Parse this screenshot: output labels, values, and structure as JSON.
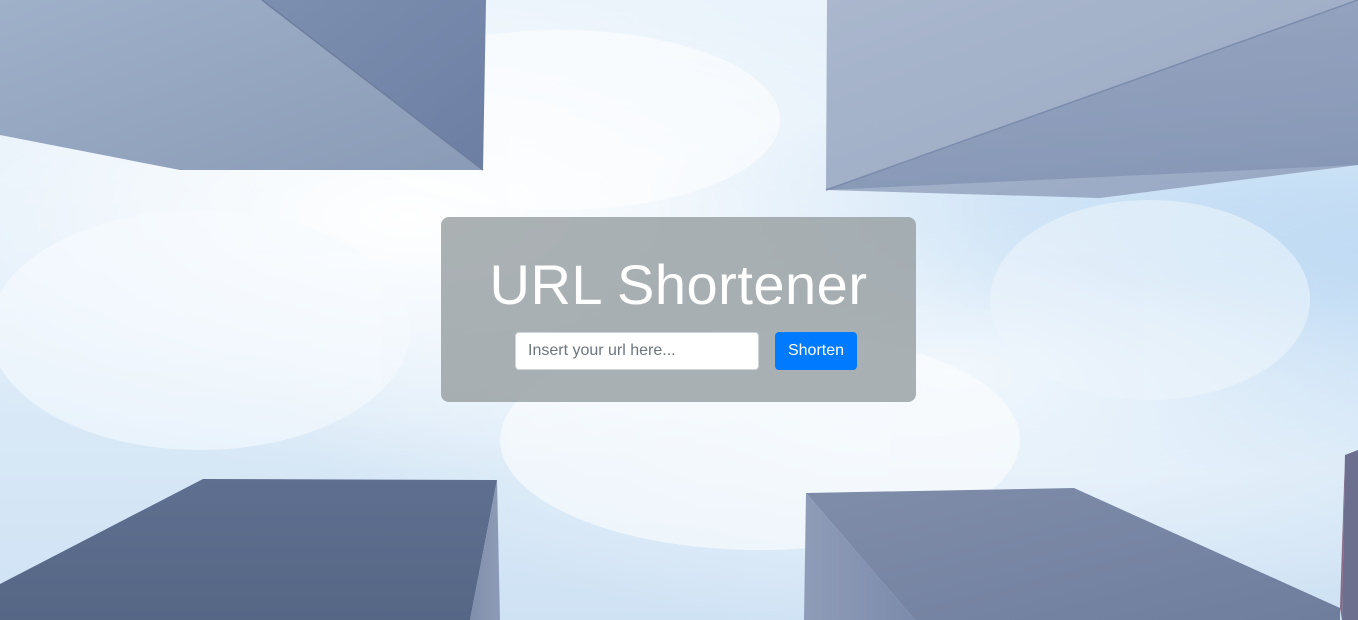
{
  "page": {
    "title": "URL Shortener"
  },
  "form": {
    "url_placeholder": "Insert your url here...",
    "url_value": "",
    "submit_label": "Shorten"
  },
  "colors": {
    "primary_button": "#007bff",
    "card_background": "rgba(148,155,158,0.78)",
    "title_text": "#ffffff"
  }
}
